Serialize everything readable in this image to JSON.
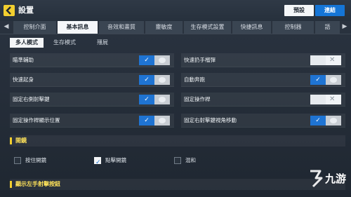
{
  "header": {
    "title": "設置",
    "preset_label": "預設",
    "connect_label": "連結"
  },
  "tabs": [
    {
      "label": "控制介面"
    },
    {
      "label": "基本訊息"
    },
    {
      "label": "音效和畫質"
    },
    {
      "label": "靈敏度"
    },
    {
      "label": "生存模式設置"
    },
    {
      "label": "快捷訊息"
    },
    {
      "label": "控制器"
    },
    {
      "label": "語"
    }
  ],
  "subtabs": [
    {
      "label": "多人模式"
    },
    {
      "label": "生存模式"
    },
    {
      "label": "殭屍"
    }
  ],
  "rows_left": [
    {
      "label": "瞄準輔助",
      "on": true
    },
    {
      "label": "快速起身",
      "on": true
    },
    {
      "label": "固定右側射擊鍵",
      "on": true
    },
    {
      "label": "固定操作桿顯示位置",
      "on": true
    }
  ],
  "rows_right": [
    {
      "label": "快速扔手榴彈",
      "on": false
    },
    {
      "label": "自動奔跑",
      "on": true
    },
    {
      "label": "固定操作桿",
      "on": false
    },
    {
      "label": "固定右射擊鍵視角移動",
      "on": true
    }
  ],
  "section_scope": {
    "title": "開鏡"
  },
  "scope_options": [
    {
      "label": "按住開鏡",
      "checked": false
    },
    {
      "label": "點擊開鏡",
      "checked": true
    },
    {
      "label": "混和",
      "checked": false
    }
  ],
  "section_fire": {
    "title": "顯示左手射擊按鈕"
  },
  "watermark": {
    "text": "九游"
  },
  "colors": {
    "accent": "#1f74d3",
    "section_text": "#ffe35a"
  }
}
